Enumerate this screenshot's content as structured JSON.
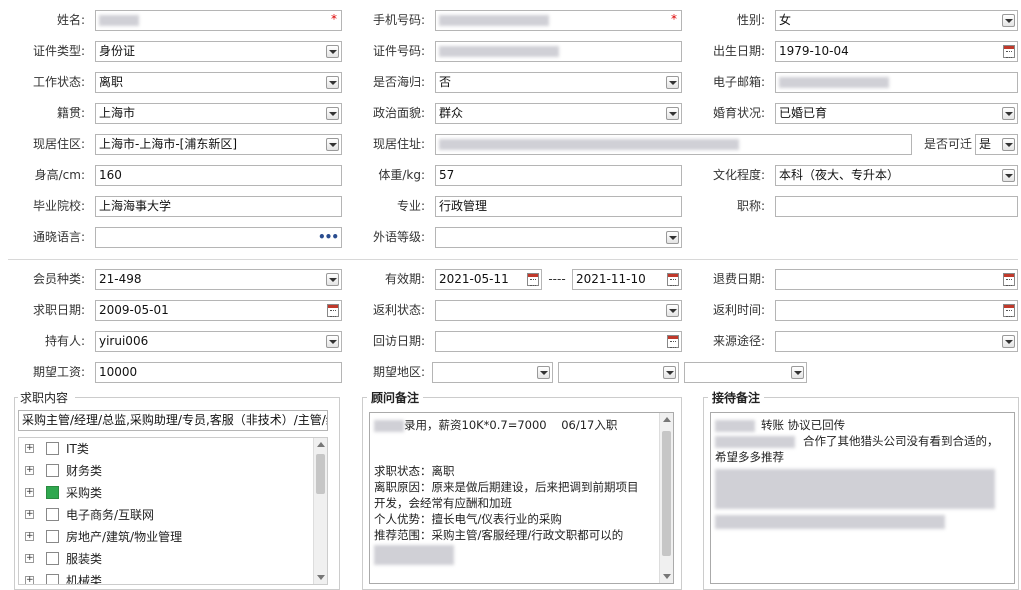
{
  "form": {
    "name": {
      "label": "姓名:",
      "required_mark": "*"
    },
    "phone": {
      "label": "手机号码:",
      "required_mark": "*"
    },
    "gender": {
      "label": "性别:",
      "value": "女"
    },
    "id_type": {
      "label": "证件类型:",
      "value": "身份证"
    },
    "id_no": {
      "label": "证件号码:"
    },
    "birthday": {
      "label": "出生日期:",
      "value": "1979-10-04"
    },
    "work_status": {
      "label": "工作状态:",
      "value": "离职"
    },
    "overseas": {
      "label": "是否海归:",
      "value": "否"
    },
    "email": {
      "label": "电子邮箱:"
    },
    "native_place": {
      "label": "籍贯:",
      "value": "上海市"
    },
    "political": {
      "label": "政治面貌:",
      "value": "群众"
    },
    "marital": {
      "label": "婚育状况:",
      "value": "已婚已育"
    },
    "residence_area": {
      "label": "现居住区:",
      "value": "上海市-上海市-[浦东新区]"
    },
    "residence_addr": {
      "label": "现居住址:"
    },
    "relocate": {
      "label": "是否可迁",
      "value": "是"
    },
    "height": {
      "label": "身高/cm:",
      "value": "160"
    },
    "weight": {
      "label": "体重/kg:",
      "value": "57"
    },
    "education": {
      "label": "文化程度:",
      "value": "本科（夜大、专升本）"
    },
    "school": {
      "label": "毕业院校:",
      "value": "上海海事大学"
    },
    "major": {
      "label": "专业:",
      "value": "行政管理"
    },
    "title": {
      "label": "职称:",
      "value": ""
    },
    "language": {
      "label": "通晓语言:",
      "value": "",
      "more": "•••"
    },
    "lang_level": {
      "label": "外语等级:",
      "value": ""
    }
  },
  "membership": {
    "type": {
      "label": "会员种类:",
      "value": "21-498"
    },
    "valid": {
      "label": "有效期:",
      "from": "2021-05-11",
      "sep": "----",
      "to": "2021-11-10"
    },
    "refund_date": {
      "label": "退费日期:",
      "value": ""
    },
    "job_date": {
      "label": "求职日期:",
      "value": "2009-05-01"
    },
    "rebate_status": {
      "label": "返利状态:",
      "value": ""
    },
    "rebate_time": {
      "label": "返利时间:",
      "value": ""
    },
    "holder": {
      "label": "持有人:",
      "value": "yirui006"
    },
    "visit_date": {
      "label": "回访日期:",
      "value": ""
    },
    "source": {
      "label": "来源途径:",
      "value": ""
    },
    "salary": {
      "label": "期望工资:",
      "value": "10000"
    },
    "region": {
      "label": "期望地区:"
    }
  },
  "job_content": {
    "title": "求职内容",
    "summary": "采购主管/经理/总监,采购助理/专员,客服（非技术）/主管/经",
    "categories": [
      {
        "label": "IT类",
        "checked": false
      },
      {
        "label": "财务类",
        "checked": false
      },
      {
        "label": "采购类",
        "checked": true
      },
      {
        "label": "电子商务/互联网",
        "checked": false
      },
      {
        "label": "房地产/建筑/物业管理",
        "checked": false
      },
      {
        "label": "服装类",
        "checked": false
      },
      {
        "label": "机械类",
        "checked": false
      }
    ]
  },
  "consultant_note": {
    "title": "顾问备注",
    "line1": "录用，薪资10K*0.7=7000    06/17入职",
    "lines": [
      "求职状态：离职",
      "离职原因：原来是做后期建设，后来把调到前期项目",
      "开发，会经常有应酬和加班",
      "个人优势：擅长电气/仪表行业的采购",
      "推荐范围：采购主管/客服经理/行政文职都可以的"
    ]
  },
  "reception_note": {
    "title": "接待备注",
    "line1": "转账 协议已回传",
    "line2": "合作了其他猎头公司没有看到合适的，",
    "line3": "希望多多推荐"
  },
  "colors": {
    "required": "#dd0000",
    "checked": "#2fa84f",
    "border": "#b5b5b5"
  }
}
